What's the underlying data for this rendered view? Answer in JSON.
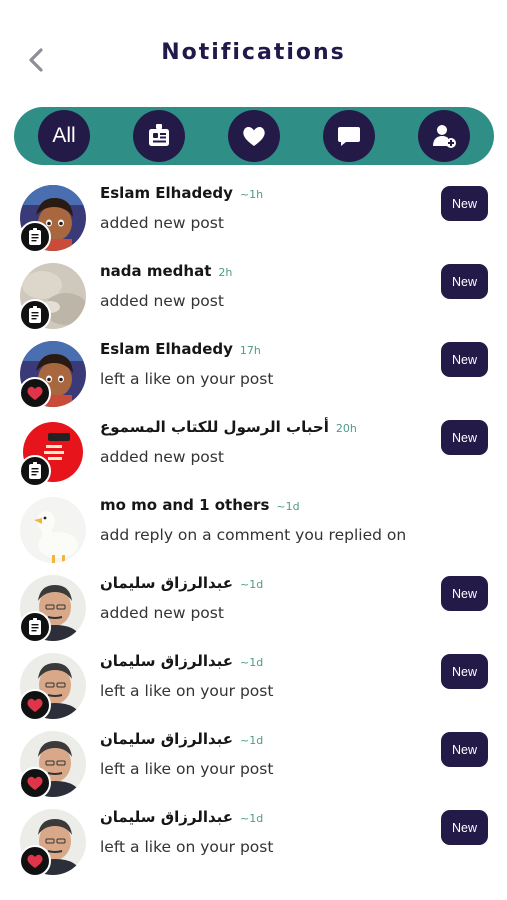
{
  "header": {
    "title": "Notifications"
  },
  "filters": [
    {
      "label": "All",
      "icon": "all"
    },
    {
      "label": "",
      "icon": "post-icon"
    },
    {
      "label": "",
      "icon": "heart-icon"
    },
    {
      "label": "",
      "icon": "comment-icon"
    },
    {
      "label": "",
      "icon": "add-user-icon"
    }
  ],
  "notifications": [
    {
      "name": "Eslam Elhadedy",
      "time": "~1h",
      "message": "added new post",
      "type": "post",
      "is_new": true,
      "badge": "New",
      "avatar": "cartoon-boy"
    },
    {
      "name": "nada medhat",
      "time": "2h",
      "message": "added new post",
      "type": "post",
      "is_new": true,
      "badge": "New",
      "avatar": "grey-photo"
    },
    {
      "name": "Eslam Elhadedy",
      "time": "17h",
      "message": "left a like on your post",
      "type": "like",
      "is_new": true,
      "badge": "New",
      "avatar": "cartoon-boy"
    },
    {
      "name": "أحباب الرسول للكتاب المسموع",
      "time": "20h",
      "message": "added new post",
      "type": "post",
      "is_new": true,
      "badge": "New",
      "avatar": "red-logo"
    },
    {
      "name": "mo mo and 1 others",
      "time": "~1d",
      "message": "add reply on a comment you replied on",
      "type": "none",
      "is_new": false,
      "badge": "",
      "avatar": "duck"
    },
    {
      "name": "عبدالرزاق سليمان",
      "time": "~1d",
      "message": "added new post",
      "type": "post",
      "is_new": true,
      "badge": "New",
      "avatar": "man"
    },
    {
      "name": "عبدالرزاق سليمان",
      "time": "~1d",
      "message": "left a like on your post",
      "type": "like",
      "is_new": true,
      "badge": "New",
      "avatar": "man"
    },
    {
      "name": "عبدالرزاق سليمان",
      "time": "~1d",
      "message": "left a like on your post",
      "type": "like",
      "is_new": true,
      "badge": "New",
      "avatar": "man"
    },
    {
      "name": "عبدالرزاق سليمان",
      "time": "~1d",
      "message": "left a like on your post",
      "type": "like",
      "is_new": true,
      "badge": "New",
      "avatar": "man"
    }
  ],
  "colors": {
    "accent": "#2f8f87",
    "dark": "#241a48",
    "time": "#4e9b8a",
    "heart": "#e0344a"
  }
}
